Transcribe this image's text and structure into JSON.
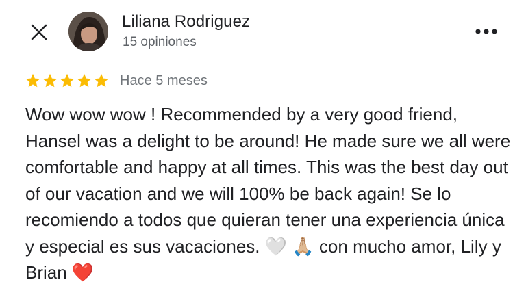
{
  "reviewer": {
    "name": "Liliana Rodriguez",
    "review_count": "15 opiniones",
    "avatar_icon": "user-avatar"
  },
  "header": {
    "close_icon": "close-icon",
    "more_icon": "more-horizontal-icon"
  },
  "review": {
    "rating": 5,
    "rating_max": 5,
    "star_color": "#fbbc04",
    "time_ago": "Hace 5 meses",
    "text": "Wow wow wow ! Recommended by a very good friend, Hansel was a delight to be around! He made sure we all were comfortable and happy at all times. This was the best day out of our vacation and we will 100% be back again! Se lo recomiendo a todos que quieran tener una experiencia única y especial es sus vacaciones. 🤍 🙏🏼 con mucho amor, Lily y Brian ❤️"
  }
}
